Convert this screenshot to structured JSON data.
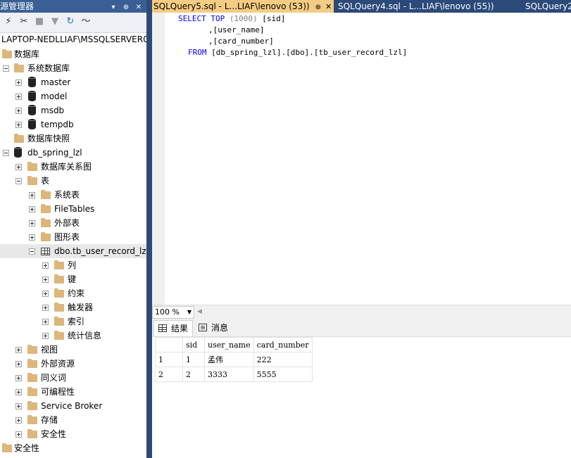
{
  "object_explorer": {
    "title": "源管理器",
    "title_buttons": [
      "▾",
      "⊕",
      "✕"
    ],
    "server": "LAPTOP-NEDLLIAF\\MSSQLSERVER0",
    "tree": {
      "databases": "数据库",
      "system_databases": "系统数据库",
      "master": "master",
      "model": "model",
      "msdb": "msdb",
      "tempdb": "tempdb",
      "snapshots": "数据库快照",
      "db_spring": "db_spring_lzl",
      "diagrams": "数据库关系图",
      "tables": "表",
      "system_tables": "系统表",
      "filetables": "FileTables",
      "external_tables": "外部表",
      "graph_tables": "图形表",
      "user_table": "dbo.tb_user_record_lz",
      "columns": "列",
      "keys": "键",
      "constraints": "约束",
      "triggers": "触发器",
      "indexes": "索引",
      "statistics": "统计信息",
      "views": "视图",
      "external_resources": "外部资源",
      "synonyms": "同义词",
      "programmability": "可编程性",
      "service_broker": "Service Broker",
      "storage": "存储",
      "security_db": "安全性",
      "security_root": "安全性"
    }
  },
  "tabs": [
    {
      "label": "SQLQuery5.sql - L...LIAF\\lenovo (53))",
      "pin": "⊕",
      "close": "✕"
    },
    {
      "label": "SQLQuery4.sql - L...LIAF\\lenovo (55))"
    },
    {
      "label": "SQLQuery2"
    }
  ],
  "editor": {
    "lines": [
      {
        "k1": "SELECT",
        "k2": "TOP",
        "rest1": " (1000) ",
        "rest2": "[sid]"
      },
      {
        "rest": ",[user_name]"
      },
      {
        "rest": ",[card_number]"
      },
      {
        "k1": "FROM",
        "rest": " [db_spring_lzl].[dbo].[tb_user_record_lzl]"
      }
    ]
  },
  "zoom": {
    "value": "100 %"
  },
  "result_tabs": {
    "results": "结果",
    "messages": "消息"
  },
  "results": {
    "columns": [
      "sid",
      "user_name",
      "card_number"
    ],
    "rows": [
      {
        "n": "1",
        "sid": "1",
        "user_name": "孟伟",
        "card_number": "222"
      },
      {
        "n": "2",
        "sid": "2",
        "user_name": "3333",
        "card_number": "5555"
      }
    ]
  }
}
